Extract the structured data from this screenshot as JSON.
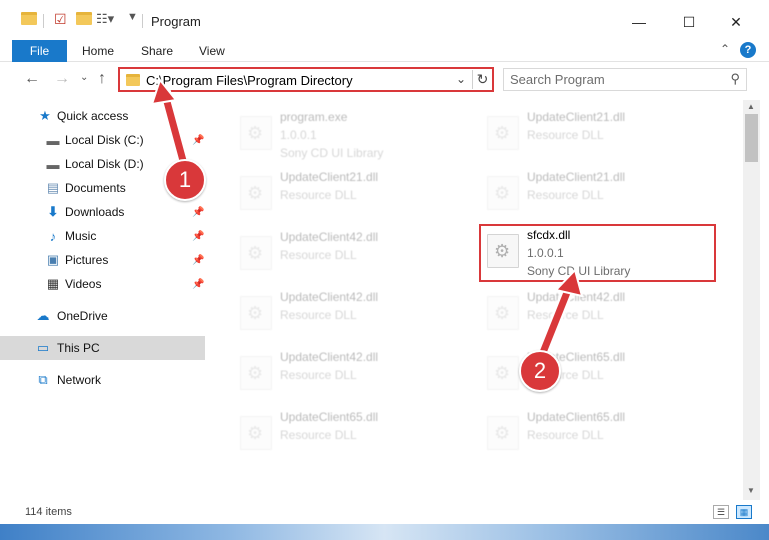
{
  "window": {
    "title": "Program",
    "minimize_glyph": "—",
    "maximize_glyph": "☐",
    "close_glyph": "✕"
  },
  "ribbon": {
    "tabs": [
      {
        "label": "File"
      },
      {
        "label": "Home"
      },
      {
        "label": "Share"
      },
      {
        "label": "View"
      }
    ],
    "help": "?"
  },
  "address": {
    "path": "C:\\Program Files\\Program Directory",
    "search_placeholder": "Search Program"
  },
  "nav": {
    "items": [
      {
        "label": "Quick access",
        "icon": "star-icon"
      },
      {
        "label": "Local Disk (C:)",
        "icon": "drive-icon",
        "pinned": true
      },
      {
        "label": "Local Disk (D:)",
        "icon": "drive-icon"
      },
      {
        "label": "Documents",
        "icon": "document-icon",
        "pinned": true
      },
      {
        "label": "Downloads",
        "icon": "download-icon",
        "pinned": true
      },
      {
        "label": "Music",
        "icon": "music-icon",
        "pinned": true
      },
      {
        "label": "Pictures",
        "icon": "picture-icon",
        "pinned": true
      },
      {
        "label": "Videos",
        "icon": "video-icon",
        "pinned": true
      },
      {
        "label": "OneDrive",
        "icon": "cloud-icon"
      },
      {
        "label": "This PC",
        "icon": "computer-icon",
        "selected": true
      },
      {
        "label": "Network",
        "icon": "network-icon"
      }
    ]
  },
  "files": [
    {
      "name": "program.exe",
      "line1": "1.0.0.1",
      "line2": "Sony CD UI Library"
    },
    {
      "name": "UpdateClient21.dll",
      "line1": "Resource DLL"
    },
    {
      "name": "UpdateClient21.dll",
      "line1": "Resource DLL"
    },
    {
      "name": "UpdateClient21.dll",
      "line1": "Resource DLL"
    },
    {
      "name": "UpdateClient42.dll",
      "line1": "Resource DLL"
    },
    {
      "name": "sfcdx.dll",
      "line1": "1.0.0.1",
      "line2": "Sony CD UI Library"
    },
    {
      "name": "UpdateClient42.dll",
      "line1": "Resource DLL"
    },
    {
      "name": "UpdateClient42.dll",
      "line1": "Resource DLL"
    },
    {
      "name": "UpdateClient42.dll",
      "line1": "Resource DLL"
    },
    {
      "name": "UpdateClient65.dll",
      "line1": "Resource DLL"
    },
    {
      "name": "UpdateClient65.dll",
      "line1": "Resource DLL"
    },
    {
      "name": "UpdateClient65.dll",
      "line1": "Resource DLL"
    }
  ],
  "status": {
    "item_count": "114 items"
  },
  "annotations": {
    "step1": "1",
    "step2": "2",
    "color": "#d9383a"
  }
}
